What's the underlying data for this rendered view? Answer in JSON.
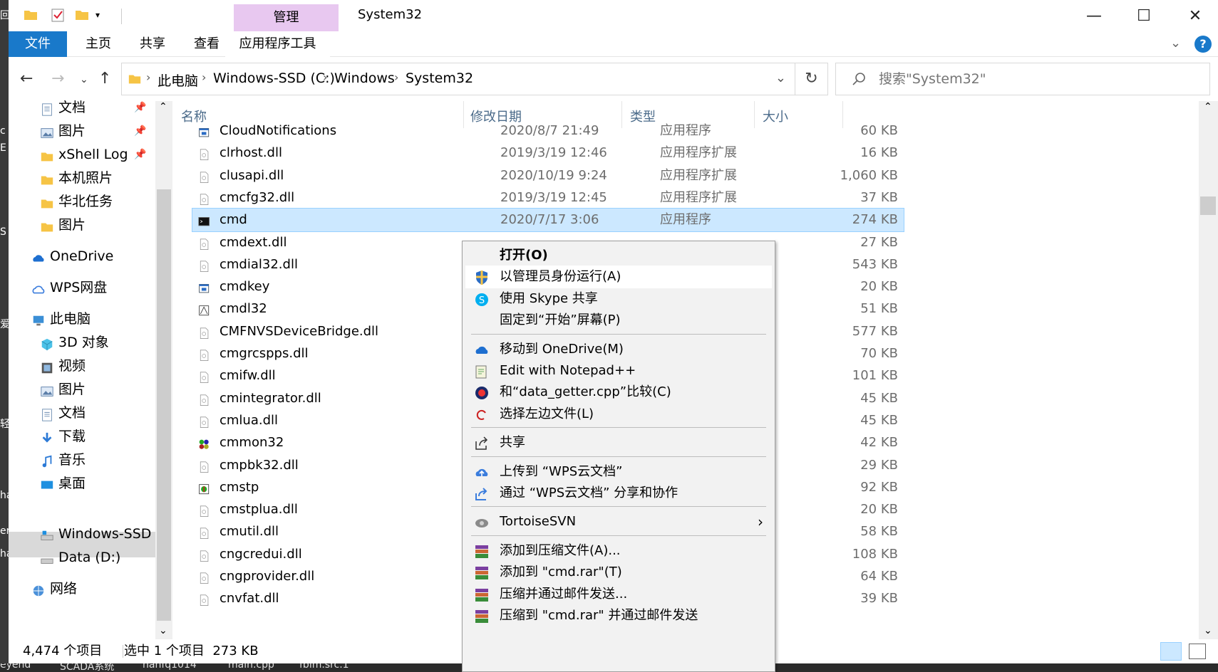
{
  "background": {
    "left_strip_fragments": [
      "回",
      "c",
      "E",
      "S",
      "爱",
      "ha",
      "er",
      "轻",
      "ha"
    ],
    "taskbar_items": [
      "eyend",
      "SCADA系统",
      "hanfq1014",
      "main.cpp",
      "fbim.src.1"
    ]
  },
  "titlebar": {
    "title": "System32",
    "contextual_tab": "管理",
    "minimize": "—",
    "maximize": "☐",
    "close": "✕"
  },
  "ribbon": {
    "tabs": [
      "文件",
      "主页",
      "共享",
      "查看",
      "应用程序工具"
    ],
    "help": "?"
  },
  "address": {
    "crumbs": [
      "此电脑",
      "Windows-SSD (C:)",
      "Windows",
      "System32"
    ],
    "search_placeholder": "搜索\"System32\""
  },
  "nav": {
    "items": [
      {
        "label": "文档",
        "icon": "documents-icon",
        "pinned": true
      },
      {
        "label": "图片",
        "icon": "pictures-icon",
        "pinned": true
      },
      {
        "label": "xShell Log",
        "icon": "folder-icon",
        "pinned": true
      },
      {
        "label": "本机照片",
        "icon": "folder-icon",
        "pinned": false
      },
      {
        "label": "华北任务",
        "icon": "folder-icon",
        "pinned": false
      },
      {
        "label": "图片",
        "icon": "folder-icon",
        "pinned": false
      },
      {
        "label": "OneDrive",
        "icon": "onedrive-icon",
        "pinned": false
      },
      {
        "label": "WPS网盘",
        "icon": "wps-cloud-icon",
        "pinned": false
      },
      {
        "label": "此电脑",
        "icon": "this-pc-icon",
        "pinned": false
      },
      {
        "label": "3D 对象",
        "icon": "3d-objects-icon",
        "pinned": false
      },
      {
        "label": "视频",
        "icon": "videos-icon",
        "pinned": false
      },
      {
        "label": "图片",
        "icon": "pictures-icon",
        "pinned": false
      },
      {
        "label": "文档",
        "icon": "documents-icon",
        "pinned": false
      },
      {
        "label": "下载",
        "icon": "downloads-icon",
        "pinned": false
      },
      {
        "label": "音乐",
        "icon": "music-icon",
        "pinned": false
      },
      {
        "label": "桌面",
        "icon": "desktop-icon",
        "pinned": false
      },
      {
        "label": "Windows-SSD (",
        "icon": "drive-c-icon",
        "pinned": false
      },
      {
        "label": "Data (D:)",
        "icon": "drive-icon",
        "pinned": false
      },
      {
        "label": "网络",
        "icon": "network-icon",
        "pinned": false
      }
    ]
  },
  "columns": {
    "name": "名称",
    "date": "修改日期",
    "type": "类型",
    "size": "大小"
  },
  "files": [
    {
      "name": "CloudNotifications",
      "date": "2020/8/7 21:49",
      "type": "应用程序",
      "size": "60 KB",
      "icon": "app-icon"
    },
    {
      "name": "clrhost.dll",
      "date": "2019/3/19 12:46",
      "type": "应用程序扩展",
      "size": "16 KB",
      "icon": "dll-icon"
    },
    {
      "name": "clusapi.dll",
      "date": "2020/10/19 9:24",
      "type": "应用程序扩展",
      "size": "1,060 KB",
      "icon": "dll-icon"
    },
    {
      "name": "cmcfg32.dll",
      "date": "2019/3/19 12:45",
      "type": "应用程序扩展",
      "size": "37 KB",
      "icon": "dll-icon"
    },
    {
      "name": "cmd",
      "date": "2020/7/17 3:06",
      "type": "应用程序",
      "size": "274 KB",
      "icon": "console-icon",
      "selected": true
    },
    {
      "name": "cmdext.dll",
      "date": "",
      "type": "",
      "size": "27 KB",
      "icon": "dll-icon"
    },
    {
      "name": "cmdial32.dll",
      "date": "",
      "type": "",
      "size": "543 KB",
      "icon": "dll-icon"
    },
    {
      "name": "cmdkey",
      "date": "",
      "type": "",
      "size": "20 KB",
      "icon": "app-icon"
    },
    {
      "name": "cmdl32",
      "date": "",
      "type": "",
      "size": "51 KB",
      "icon": "cmdl32-icon"
    },
    {
      "name": "CMFNVSDeviceBridge.dll",
      "date": "",
      "type": "",
      "size": "577 KB",
      "icon": "dll-icon"
    },
    {
      "name": "cmgrcspps.dll",
      "date": "",
      "type": "",
      "size": "70 KB",
      "icon": "dll-icon"
    },
    {
      "name": "cmifw.dll",
      "date": "",
      "type": "",
      "size": "101 KB",
      "icon": "dll-icon"
    },
    {
      "name": "cmintegrator.dll",
      "date": "",
      "type": "",
      "size": "45 KB",
      "icon": "dll-icon"
    },
    {
      "name": "cmlua.dll",
      "date": "",
      "type": "",
      "size": "45 KB",
      "icon": "dll-icon"
    },
    {
      "name": "cmmon32",
      "date": "",
      "type": "",
      "size": "42 KB",
      "icon": "cmmon-icon"
    },
    {
      "name": "cmpbk32.dll",
      "date": "",
      "type": "",
      "size": "29 KB",
      "icon": "dll-icon"
    },
    {
      "name": "cmstp",
      "date": "",
      "type": "",
      "size": "92 KB",
      "icon": "cmstp-icon"
    },
    {
      "name": "cmstplua.dll",
      "date": "",
      "type": "",
      "size": "20 KB",
      "icon": "dll-icon"
    },
    {
      "name": "cmutil.dll",
      "date": "",
      "type": "",
      "size": "58 KB",
      "icon": "dll-icon"
    },
    {
      "name": "cngcredui.dll",
      "date": "",
      "type": "",
      "size": "108 KB",
      "icon": "dll-icon"
    },
    {
      "name": "cngprovider.dll",
      "date": "",
      "type": "",
      "size": "64 KB",
      "icon": "dll-icon"
    },
    {
      "name": "cnvfat.dll",
      "date": "",
      "type": "",
      "size": "39 KB",
      "icon": "dll-icon"
    }
  ],
  "context_menu": {
    "items": [
      {
        "label": "打开(O)",
        "icon": "",
        "bold": true
      },
      {
        "label": "以管理员身份运行(A)",
        "icon": "uac-shield-icon",
        "highlight": true
      },
      {
        "label": "使用 Skype 共享",
        "icon": "skype-icon"
      },
      {
        "label": "固定到“开始”屏幕(P)",
        "icon": ""
      },
      {
        "sep": true
      },
      {
        "label": "移动到 OneDrive(M)",
        "icon": "onedrive-icon"
      },
      {
        "label": "Edit with Notepad++",
        "icon": "notepadpp-icon"
      },
      {
        "label": "和“data_getter.cpp”比较(C)",
        "icon": "compare-icon"
      },
      {
        "label": "选择左边文件(L)",
        "icon": "select-left-icon"
      },
      {
        "sep": true
      },
      {
        "label": "共享",
        "icon": "share-icon"
      },
      {
        "sep": true
      },
      {
        "label": "上传到 “WPS云文档”",
        "icon": "wps-upload-icon"
      },
      {
        "label": "通过 “WPS云文档” 分享和协作",
        "icon": "wps-share-icon"
      },
      {
        "sep": true
      },
      {
        "label": "TortoiseSVN",
        "icon": "tortoisesvn-icon",
        "submenu": true
      },
      {
        "sep": true
      },
      {
        "label": "添加到压缩文件(A)...",
        "icon": "winrar-icon"
      },
      {
        "label": "添加到 \"cmd.rar\"(T)",
        "icon": "winrar-icon"
      },
      {
        "label": "压缩并通过邮件发送...",
        "icon": "winrar-icon"
      },
      {
        "label": "压缩到 \"cmd.rar\" 并通过邮件发送",
        "icon": "winrar-icon"
      }
    ]
  },
  "status": {
    "count": "4,474 个项目",
    "selection": "选中 1 个项目  273 KB"
  },
  "colors": {
    "accent": "#1979ca",
    "selection": "#cce8ff",
    "manage_tab": "#e8c8f0"
  }
}
